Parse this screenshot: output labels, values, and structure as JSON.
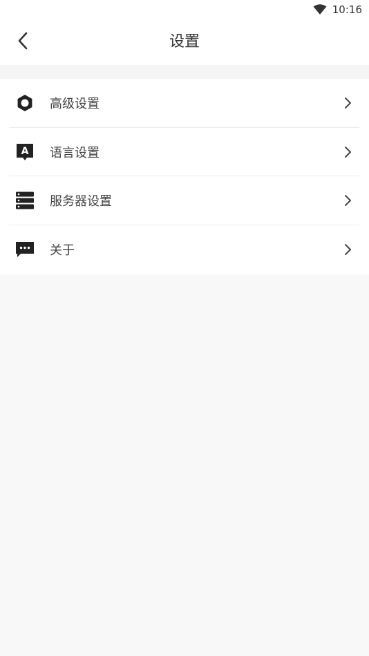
{
  "status_bar": {
    "time": "10:16",
    "wifi_icon": "wifi-icon"
  },
  "nav": {
    "title": "设置",
    "back_icon": "chevron-left-icon"
  },
  "menu": {
    "items": [
      {
        "label": "高级设置",
        "icon": "gear-icon"
      },
      {
        "label": "语言设置",
        "icon": "language-icon"
      },
      {
        "label": "服务器设置",
        "icon": "server-icon"
      },
      {
        "label": "关于",
        "icon": "message-dots-icon"
      }
    ],
    "chevron_icon": "chevron-right-icon"
  },
  "colors": {
    "background": "#f8f8f8",
    "surface": "#ffffff",
    "text": "#333333",
    "icon": "#222222",
    "divider": "#ececec"
  }
}
